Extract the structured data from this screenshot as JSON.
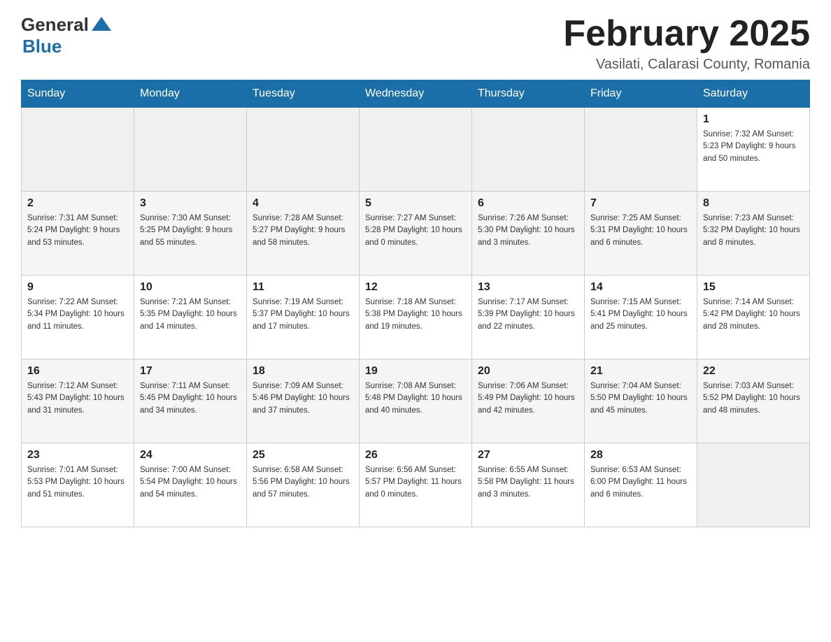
{
  "header": {
    "logo_general": "General",
    "logo_blue": "Blue",
    "month_title": "February 2025",
    "location": "Vasilati, Calarasi County, Romania"
  },
  "weekdays": [
    "Sunday",
    "Monday",
    "Tuesday",
    "Wednesday",
    "Thursday",
    "Friday",
    "Saturday"
  ],
  "weeks": [
    [
      {
        "day": "",
        "info": ""
      },
      {
        "day": "",
        "info": ""
      },
      {
        "day": "",
        "info": ""
      },
      {
        "day": "",
        "info": ""
      },
      {
        "day": "",
        "info": ""
      },
      {
        "day": "",
        "info": ""
      },
      {
        "day": "1",
        "info": "Sunrise: 7:32 AM\nSunset: 5:23 PM\nDaylight: 9 hours and 50 minutes."
      }
    ],
    [
      {
        "day": "2",
        "info": "Sunrise: 7:31 AM\nSunset: 5:24 PM\nDaylight: 9 hours and 53 minutes."
      },
      {
        "day": "3",
        "info": "Sunrise: 7:30 AM\nSunset: 5:25 PM\nDaylight: 9 hours and 55 minutes."
      },
      {
        "day": "4",
        "info": "Sunrise: 7:28 AM\nSunset: 5:27 PM\nDaylight: 9 hours and 58 minutes."
      },
      {
        "day": "5",
        "info": "Sunrise: 7:27 AM\nSunset: 5:28 PM\nDaylight: 10 hours and 0 minutes."
      },
      {
        "day": "6",
        "info": "Sunrise: 7:26 AM\nSunset: 5:30 PM\nDaylight: 10 hours and 3 minutes."
      },
      {
        "day": "7",
        "info": "Sunrise: 7:25 AM\nSunset: 5:31 PM\nDaylight: 10 hours and 6 minutes."
      },
      {
        "day": "8",
        "info": "Sunrise: 7:23 AM\nSunset: 5:32 PM\nDaylight: 10 hours and 8 minutes."
      }
    ],
    [
      {
        "day": "9",
        "info": "Sunrise: 7:22 AM\nSunset: 5:34 PM\nDaylight: 10 hours and 11 minutes."
      },
      {
        "day": "10",
        "info": "Sunrise: 7:21 AM\nSunset: 5:35 PM\nDaylight: 10 hours and 14 minutes."
      },
      {
        "day": "11",
        "info": "Sunrise: 7:19 AM\nSunset: 5:37 PM\nDaylight: 10 hours and 17 minutes."
      },
      {
        "day": "12",
        "info": "Sunrise: 7:18 AM\nSunset: 5:38 PM\nDaylight: 10 hours and 19 minutes."
      },
      {
        "day": "13",
        "info": "Sunrise: 7:17 AM\nSunset: 5:39 PM\nDaylight: 10 hours and 22 minutes."
      },
      {
        "day": "14",
        "info": "Sunrise: 7:15 AM\nSunset: 5:41 PM\nDaylight: 10 hours and 25 minutes."
      },
      {
        "day": "15",
        "info": "Sunrise: 7:14 AM\nSunset: 5:42 PM\nDaylight: 10 hours and 28 minutes."
      }
    ],
    [
      {
        "day": "16",
        "info": "Sunrise: 7:12 AM\nSunset: 5:43 PM\nDaylight: 10 hours and 31 minutes."
      },
      {
        "day": "17",
        "info": "Sunrise: 7:11 AM\nSunset: 5:45 PM\nDaylight: 10 hours and 34 minutes."
      },
      {
        "day": "18",
        "info": "Sunrise: 7:09 AM\nSunset: 5:46 PM\nDaylight: 10 hours and 37 minutes."
      },
      {
        "day": "19",
        "info": "Sunrise: 7:08 AM\nSunset: 5:48 PM\nDaylight: 10 hours and 40 minutes."
      },
      {
        "day": "20",
        "info": "Sunrise: 7:06 AM\nSunset: 5:49 PM\nDaylight: 10 hours and 42 minutes."
      },
      {
        "day": "21",
        "info": "Sunrise: 7:04 AM\nSunset: 5:50 PM\nDaylight: 10 hours and 45 minutes."
      },
      {
        "day": "22",
        "info": "Sunrise: 7:03 AM\nSunset: 5:52 PM\nDaylight: 10 hours and 48 minutes."
      }
    ],
    [
      {
        "day": "23",
        "info": "Sunrise: 7:01 AM\nSunset: 5:53 PM\nDaylight: 10 hours and 51 minutes."
      },
      {
        "day": "24",
        "info": "Sunrise: 7:00 AM\nSunset: 5:54 PM\nDaylight: 10 hours and 54 minutes."
      },
      {
        "day": "25",
        "info": "Sunrise: 6:58 AM\nSunset: 5:56 PM\nDaylight: 10 hours and 57 minutes."
      },
      {
        "day": "26",
        "info": "Sunrise: 6:56 AM\nSunset: 5:57 PM\nDaylight: 11 hours and 0 minutes."
      },
      {
        "day": "27",
        "info": "Sunrise: 6:55 AM\nSunset: 5:58 PM\nDaylight: 11 hours and 3 minutes."
      },
      {
        "day": "28",
        "info": "Sunrise: 6:53 AM\nSunset: 6:00 PM\nDaylight: 11 hours and 6 minutes."
      },
      {
        "day": "",
        "info": ""
      }
    ]
  ]
}
